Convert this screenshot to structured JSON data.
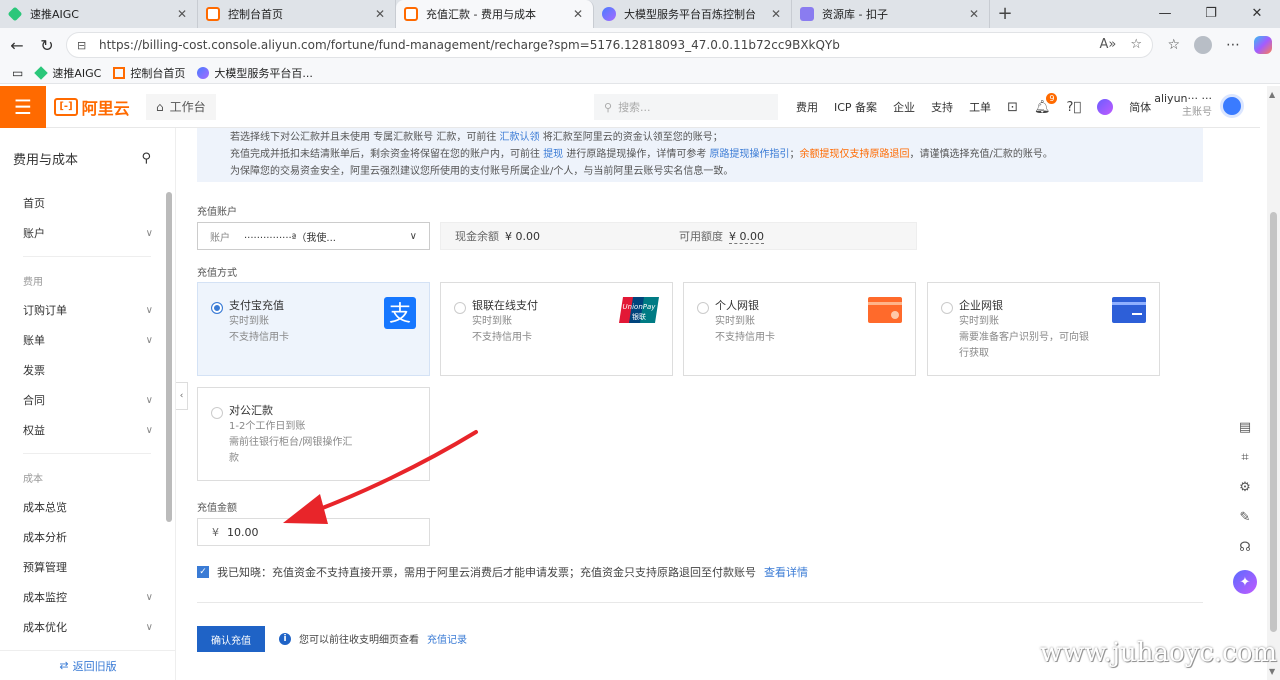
{
  "browser": {
    "tabs": [
      {
        "title": "速推AIGC",
        "color": "#2bc77a"
      },
      {
        "title": "控制台首页",
        "color": "#ff6a00"
      },
      {
        "title": "充值汇款 - 费用与成本",
        "color": "#ff6a00"
      },
      {
        "title": "大模型服务平台百炼控制台",
        "color": "#4a7cff"
      },
      {
        "title": "资源库 - 扣子",
        "color": "#8a7cf0"
      }
    ],
    "url": "https://billing-cost.console.aliyun.com/fortune/fund-management/recharge?spm=5176.12818093_47.0.0.11b72cc9BXkQYb",
    "bookmarks": [
      {
        "label": "速推AIGC",
        "color": "#2bc77a"
      },
      {
        "label": "控制台首页",
        "color": "#ff6a00"
      },
      {
        "label": "大模型服务平台百...",
        "color": "#4a7cff"
      }
    ]
  },
  "topbar": {
    "logo": "阿里云",
    "logo_mark": "[-]",
    "workbench": "工作台",
    "search_placeholder": "搜索...",
    "nav": [
      "费用",
      "ICP 备案",
      "企业",
      "支持",
      "工单"
    ],
    "badge": "9",
    "lang": "简体",
    "account_name": "aliyun··· ···",
    "account_role": "主账号"
  },
  "sidebar": {
    "title": "费用与成本",
    "items_top": [
      {
        "label": "首页",
        "chev": ""
      },
      {
        "label": "账户",
        "chev": "∨"
      }
    ],
    "group1": "费用",
    "items_fee": [
      {
        "label": "订购订单",
        "chev": "∨"
      },
      {
        "label": "账单",
        "chev": "∨"
      },
      {
        "label": "发票",
        "chev": ""
      },
      {
        "label": "合同",
        "chev": "∨"
      },
      {
        "label": "权益",
        "chev": "∨"
      }
    ],
    "group2": "成本",
    "items_cost": [
      {
        "label": "成本总览",
        "chev": ""
      },
      {
        "label": "成本分析",
        "chev": ""
      },
      {
        "label": "预算管理",
        "chev": ""
      },
      {
        "label": "成本监控",
        "chev": "∨"
      },
      {
        "label": "成本优化",
        "chev": "∨"
      }
    ],
    "footer": "返回旧版"
  },
  "notice": {
    "l1a": "若选择线下对公汇款并且未使用 专属汇款账号 汇款，可前往 ",
    "l1link": "汇款认领",
    "l1b": " 将汇款至阿里云的资金认领至您的账号；",
    "l2a": "充值完成并抵扣未结清账单后，剩余资金将保留在您的账户内，可前往 ",
    "l2link1": "提现",
    "l2b": " 进行原路提现操作，详情可参考 ",
    "l2link2": "原路提现操作指引",
    "l2c": "；",
    "l2orange": "余额提现仅支持原路退回",
    "l2d": "，请谨慎选择充值/汇款的账号。",
    "l3": "为保障您的交易资金安全，阿里云强烈建议您所使用的支付账号所属企业/个人，与当前阿里云账号实名信息一致。"
  },
  "recharge_account": {
    "label": "充值账户",
    "prefix": "账户",
    "value": "···············ª（我使...",
    "cash_label": "现金余额",
    "cash_value": "¥ 0.00",
    "credit_label": "可用额度",
    "credit_value": "¥ 0.00"
  },
  "methods": {
    "label": "充值方式",
    "items": [
      {
        "name": "支付宝充值",
        "l1": "实时到账",
        "l2": "不支持信用卡",
        "l3": "",
        "selected": true
      },
      {
        "name": "银联在线支付",
        "l1": "实时到账",
        "l2": "不支持信用卡",
        "l3": "",
        "selected": false
      },
      {
        "name": "个人网银",
        "l1": "实时到账",
        "l2": "不支持信用卡",
        "l3": "",
        "selected": false
      },
      {
        "name": "企业网银",
        "l1": "实时到账",
        "l2": "需要准备客户识别号，可向银",
        "l3": "行获取",
        "selected": false
      },
      {
        "name": "对公汇款",
        "l1": "1-2个工作日到账",
        "l2": "需前往银行柜台/网银操作汇",
        "l3": "款",
        "selected": false
      }
    ],
    "unionpay_text": "UnionPay",
    "unionpay_cn": "银联"
  },
  "amount": {
    "label": "充值金额",
    "currency": "¥",
    "value": "10.00"
  },
  "agree": {
    "text": "我已知晓：充值资金不支持直接开票，需用于阿里云消费后才能申请发票；充值资金只支持原路退回至付款账号",
    "link": "查看详情"
  },
  "confirm": "确认充值",
  "info": {
    "text": "您可以前往收支明细页查看",
    "link": "充值记录"
  },
  "watermark": "www.juhaoyc.com",
  "colors": {
    "brand": "#ff6a00",
    "primary": "#1f63c6",
    "link": "#3a7bd5",
    "arrow": "#e8252a"
  }
}
